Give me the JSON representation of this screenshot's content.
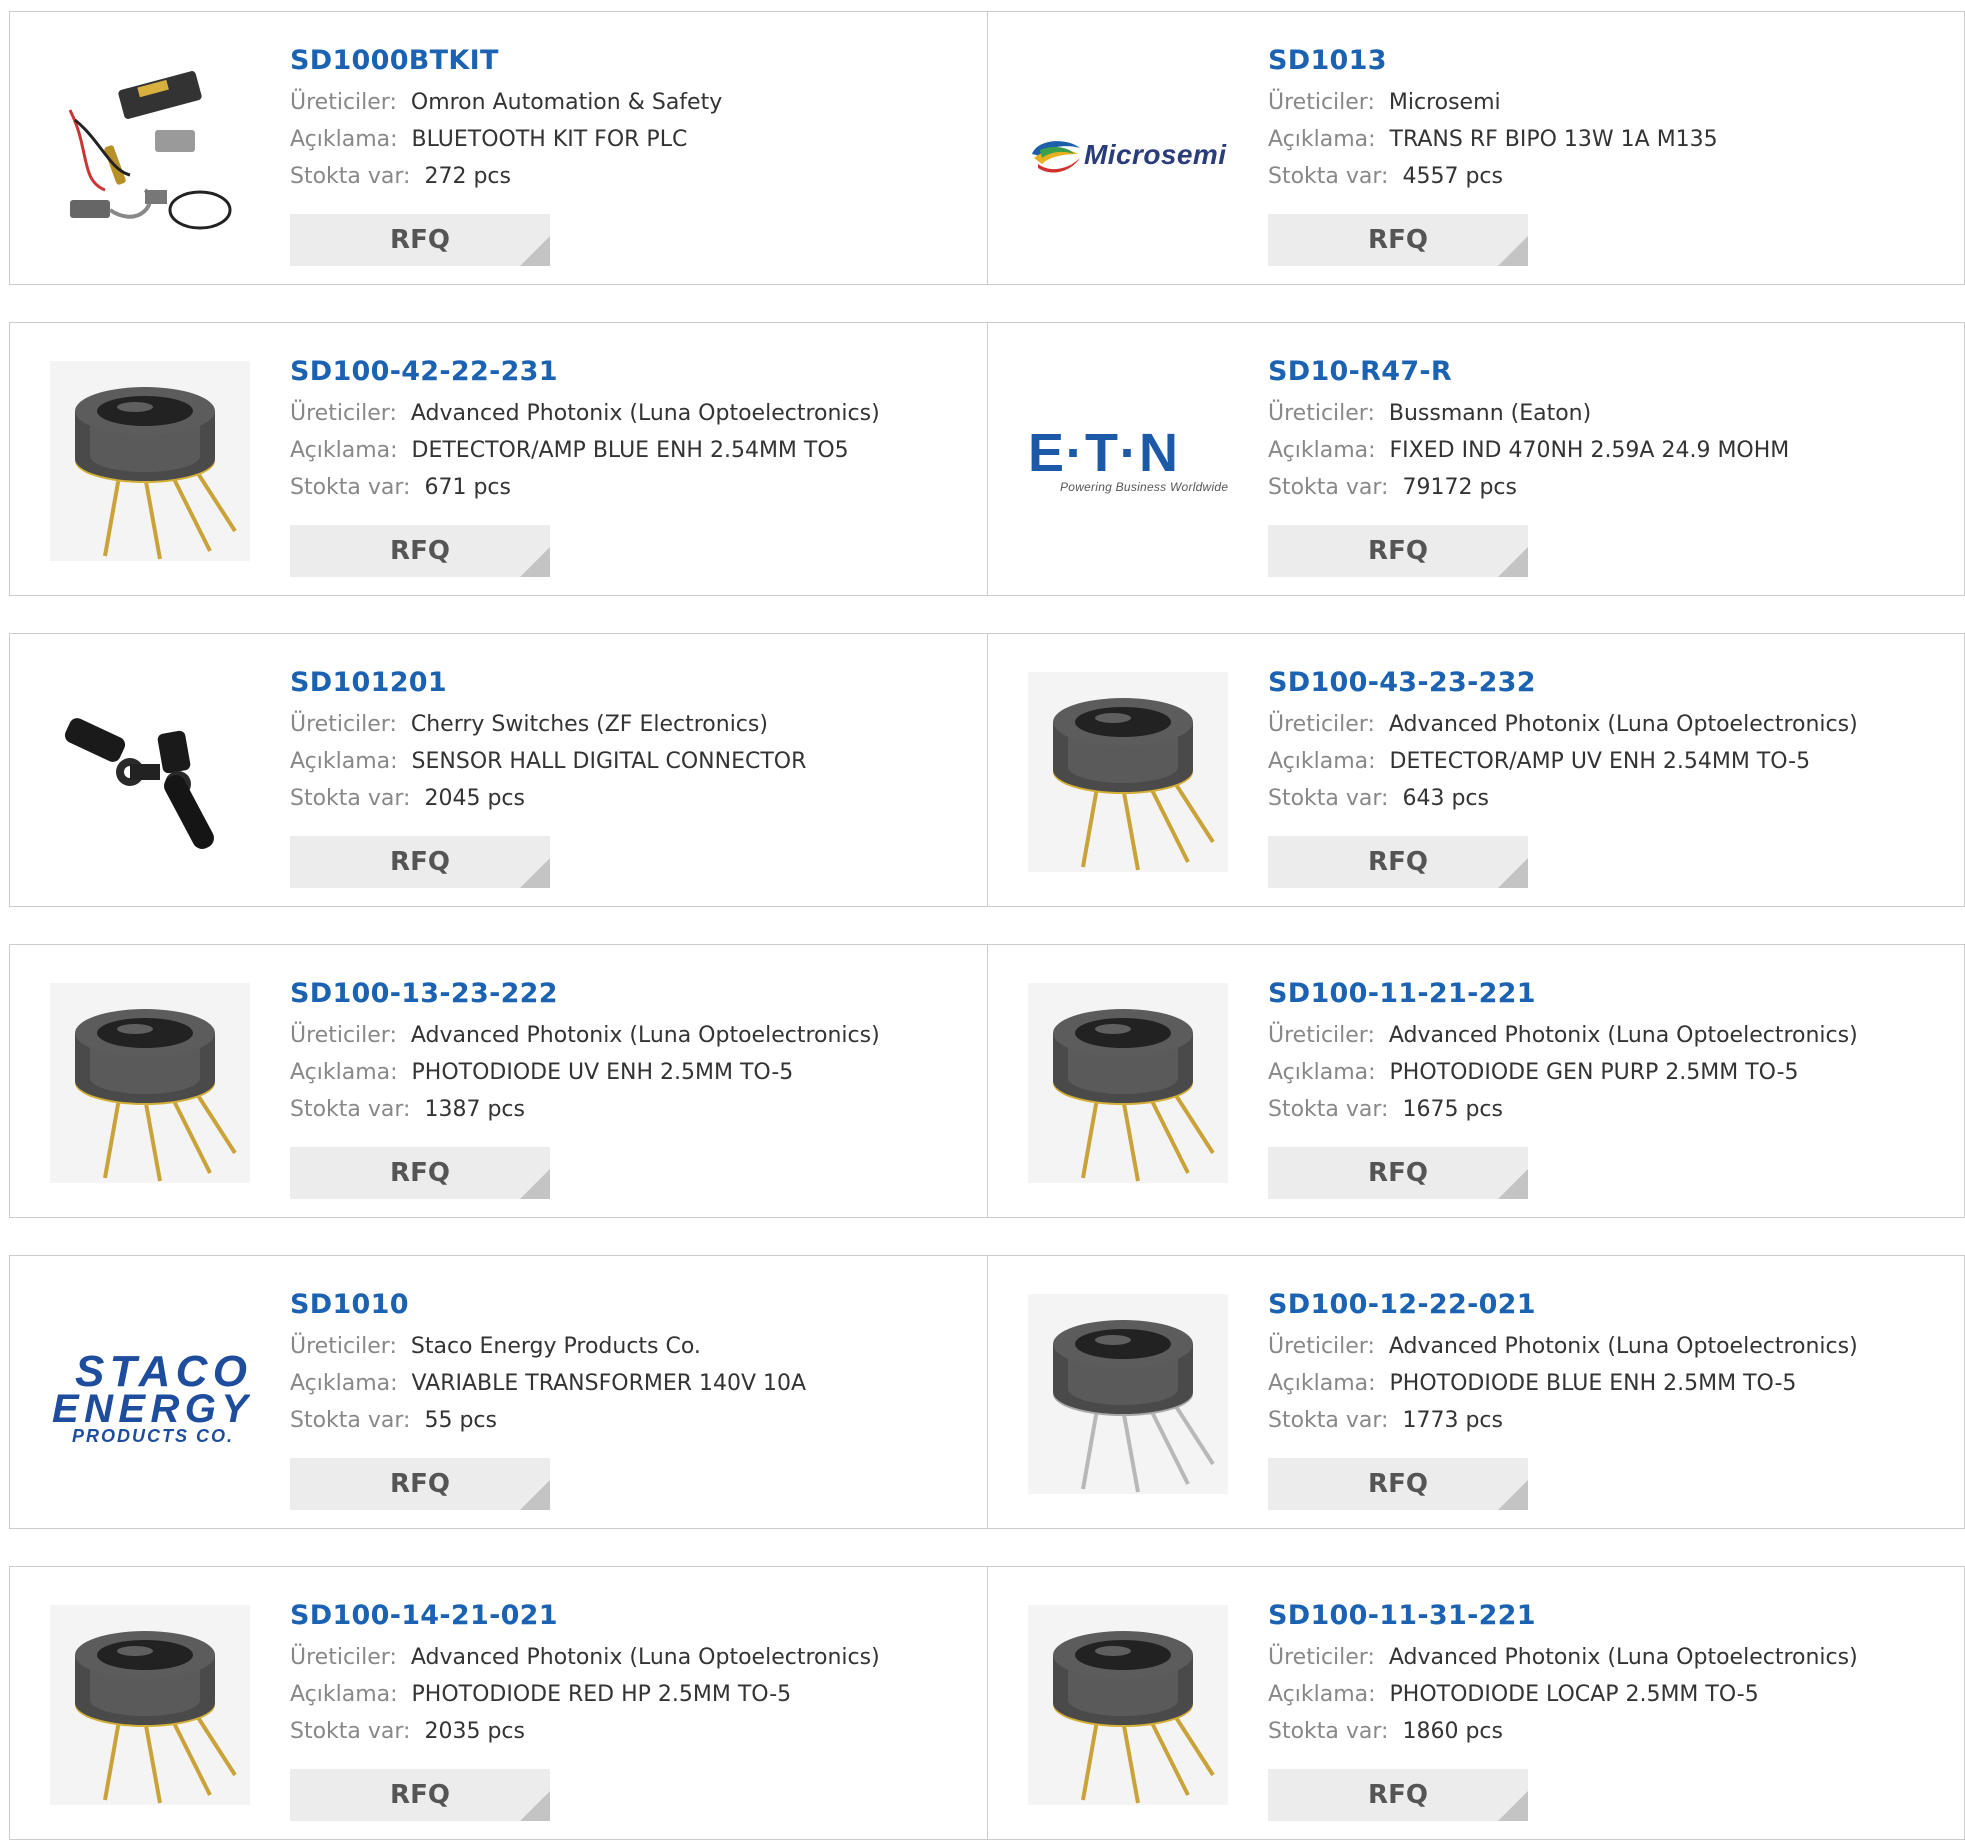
{
  "labels": {
    "manufacturer": "Üreticiler:",
    "description": "Açıklama:",
    "stock": "Stokta var:",
    "rfq": "RFQ"
  },
  "colors": {
    "part_link": "#1b63b2",
    "label_gray": "#888888",
    "value_dark": "#333333",
    "button_bg": "#ececec",
    "border": "#cccccc"
  },
  "products": [
    {
      "part": "SD1000BTKIT",
      "manufacturer": "Omron Automation & Safety",
      "description": "BLUETOOTH KIT FOR PLC",
      "stock": "272 pcs",
      "image": "kit-cables"
    },
    {
      "part": "SD1013",
      "manufacturer": "Microsemi",
      "description": "TRANS RF BIPO 13W 1A M135",
      "stock": "4557 pcs",
      "image": "microsemi-logo",
      "logo_text": "Microsemi"
    },
    {
      "part": "SD100-42-22-231",
      "manufacturer": "Advanced Photonix (Luna Optoelectronics)",
      "description": "DETECTOR/AMP BLUE ENH 2.54MM TO5",
      "stock": "671 pcs",
      "image": "to5-can-gold"
    },
    {
      "part": "SD10-R47-R",
      "manufacturer": "Bussmann (Eaton)",
      "description": "FIXED IND 470NH 2.59A 24.9 MOHM",
      "stock": "79172 pcs",
      "image": "eaton-logo",
      "logo_text": "E·T·N",
      "logo_tagline": "Powering Business Worldwide"
    },
    {
      "part": "SD101201",
      "manufacturer": "Cherry Switches (ZF Electronics)",
      "description": "SENSOR HALL DIGITAL CONNECTOR",
      "stock": "2045 pcs",
      "image": "hall-sensor"
    },
    {
      "part": "SD100-43-23-232",
      "manufacturer": "Advanced Photonix (Luna Optoelectronics)",
      "description": "DETECTOR/AMP UV ENH 2.54MM TO-5",
      "stock": "643 pcs",
      "image": "to5-can-gold"
    },
    {
      "part": "SD100-13-23-222",
      "manufacturer": "Advanced Photonix (Luna Optoelectronics)",
      "description": "PHOTODIODE UV ENH 2.5MM TO-5",
      "stock": "1387 pcs",
      "image": "to5-can-gold"
    },
    {
      "part": "SD100-11-21-221",
      "manufacturer": "Advanced Photonix (Luna Optoelectronics)",
      "description": "PHOTODIODE GEN PURP 2.5MM TO-5",
      "stock": "1675 pcs",
      "image": "to5-can-gold"
    },
    {
      "part": "SD1010",
      "manufacturer": "Staco Energy Products Co.",
      "description": "VARIABLE TRANSFORMER 140V 10A",
      "stock": "55 pcs",
      "image": "staco-logo",
      "logo_lines": [
        "STACO",
        "ENERGY",
        "PRODUCTS CO."
      ]
    },
    {
      "part": "SD100-12-22-021",
      "manufacturer": "Advanced Photonix (Luna Optoelectronics)",
      "description": "PHOTODIODE BLUE ENH 2.5MM TO-5",
      "stock": "1773 pcs",
      "image": "to5-can-silver"
    },
    {
      "part": "SD100-14-21-021",
      "manufacturer": "Advanced Photonix (Luna Optoelectronics)",
      "description": "PHOTODIODE RED HP 2.5MM TO-5",
      "stock": "2035 pcs",
      "image": "to5-can-gold"
    },
    {
      "part": "SD100-11-31-221",
      "manufacturer": "Advanced Photonix (Luna Optoelectronics)",
      "description": "PHOTODIODE LOCAP 2.5MM TO-5",
      "stock": "1860 pcs",
      "image": "to5-can-gold"
    }
  ]
}
